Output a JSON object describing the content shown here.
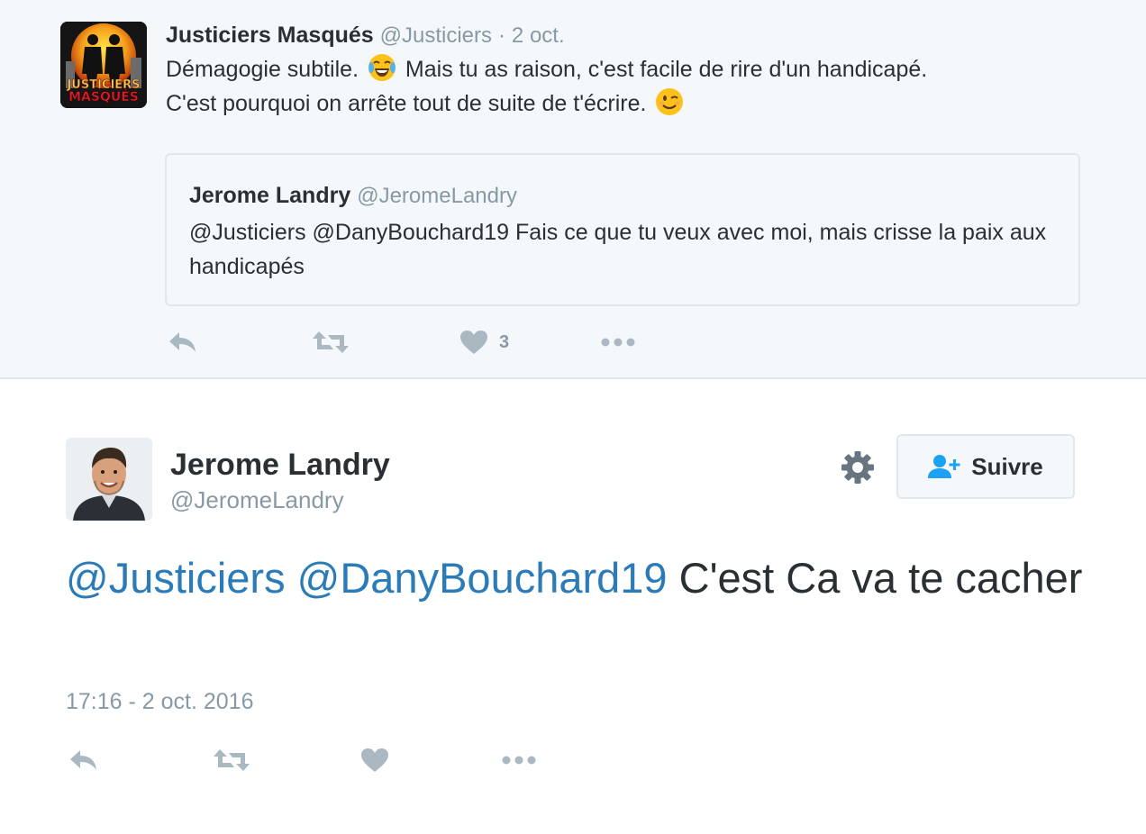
{
  "parent_tweet": {
    "author_name": "Justiciers Masqués",
    "author_handle": "@Justiciers",
    "separator": "·",
    "time": "2 oct.",
    "avatar_text_line1": "JUSTICIERS",
    "avatar_text_line2": "MASQUÉS",
    "text_line1_a": "Démagogie subtile.",
    "text_line1_b": "Mais tu as raison, c'est facile de rire d'un handicapé.",
    "text_line2": "C'est pourquoi on arrête tout de suite de t'écrire.",
    "quoted": {
      "author_name": "Jerome Landry",
      "author_handle": "@JeromeLandry",
      "text": "@Justiciers @DanyBouchard19 Fais ce que tu veux avec moi, mais crisse la paix aux handicapés"
    },
    "actions": {
      "like_count": "3",
      "icons": [
        "reply-icon",
        "retweet-icon",
        "heart-icon",
        "more-icon"
      ]
    }
  },
  "main_tweet": {
    "author_name": "Jerome Landry",
    "author_handle": "@JeromeLandry",
    "follow_label": "Suivre",
    "mention1": "@Justiciers",
    "mention2": "@DanyBouchard19",
    "text": "C'est Ca va te cacher",
    "timestamp": "17:16 - 2 oct. 2016",
    "actions": {
      "icons": [
        "reply-icon",
        "retweet-icon",
        "heart-icon",
        "more-icon"
      ]
    }
  },
  "colors": {
    "background_parent": "#f5f8fa",
    "text": "#292f33",
    "muted": "#8899a6",
    "link": "#2b7bb9",
    "icon": "#aab8c2",
    "follow_icon": "#1da1f2"
  }
}
